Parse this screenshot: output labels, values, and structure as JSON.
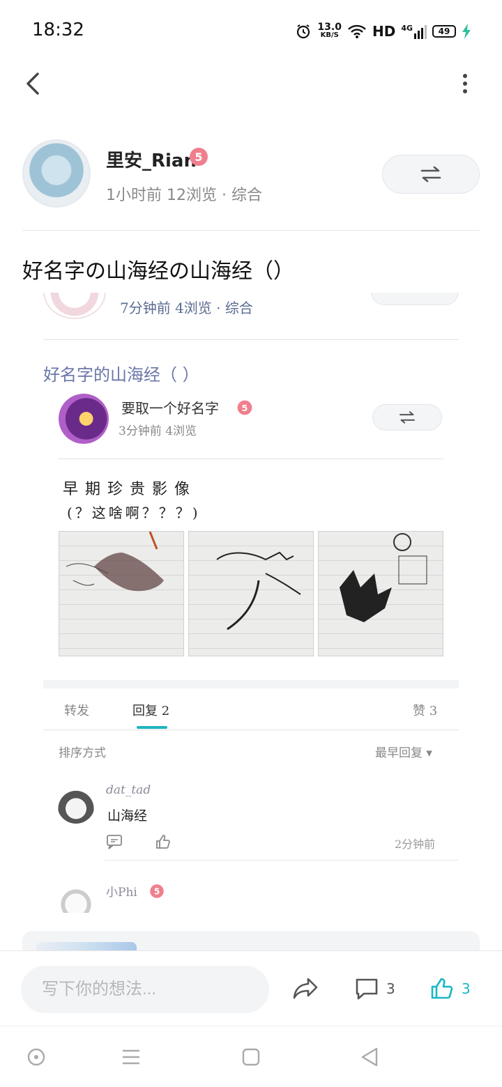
{
  "status_bar": {
    "time": "18:32",
    "net_speed_value": "13.0",
    "net_speed_unit": "KB/S",
    "hd_label": "HD",
    "network_label": "4G",
    "battery": "49",
    "icons": [
      "alarm-icon",
      "wifi-icon",
      "signal-icon",
      "battery-icon",
      "charging-icon"
    ]
  },
  "app_bar": {
    "back_icon": "chevron-left-icon",
    "more_icon": "more-vertical-icon"
  },
  "post": {
    "author": "里安_Rian",
    "level": "5",
    "meta": "1小时前  12浏览 · 综合",
    "title": "好名字の山海经の山海经（）"
  },
  "embed": {
    "top_meta": "7分钟前  4浏览   ·  综合",
    "inner_title": "好名字的山海经（ ）",
    "inner_author": "要取一个好名字",
    "inner_level": "5",
    "inner_meta": "3分钟前 4浏览",
    "inner_line1": "早期珍贵影像",
    "inner_line2": "(？这啥啊？？？)",
    "tabs": {
      "forward": "转发",
      "reply": "回复 2",
      "like": "赞 3"
    },
    "sort_label": "排序方式",
    "sort_value": "最早回复",
    "comments": [
      {
        "user": "dat_tad",
        "text": "山海经",
        "time": "2分钟前"
      },
      {
        "user": "小Phi",
        "level": "5"
      }
    ]
  },
  "bottom_bar": {
    "input_placeholder": "写下你的想法...",
    "comment_count": "3",
    "like_count": "3"
  },
  "colors": {
    "accent": "#19b7c4",
    "level_badge": "#f07f8e",
    "meta_text": "#888888"
  }
}
